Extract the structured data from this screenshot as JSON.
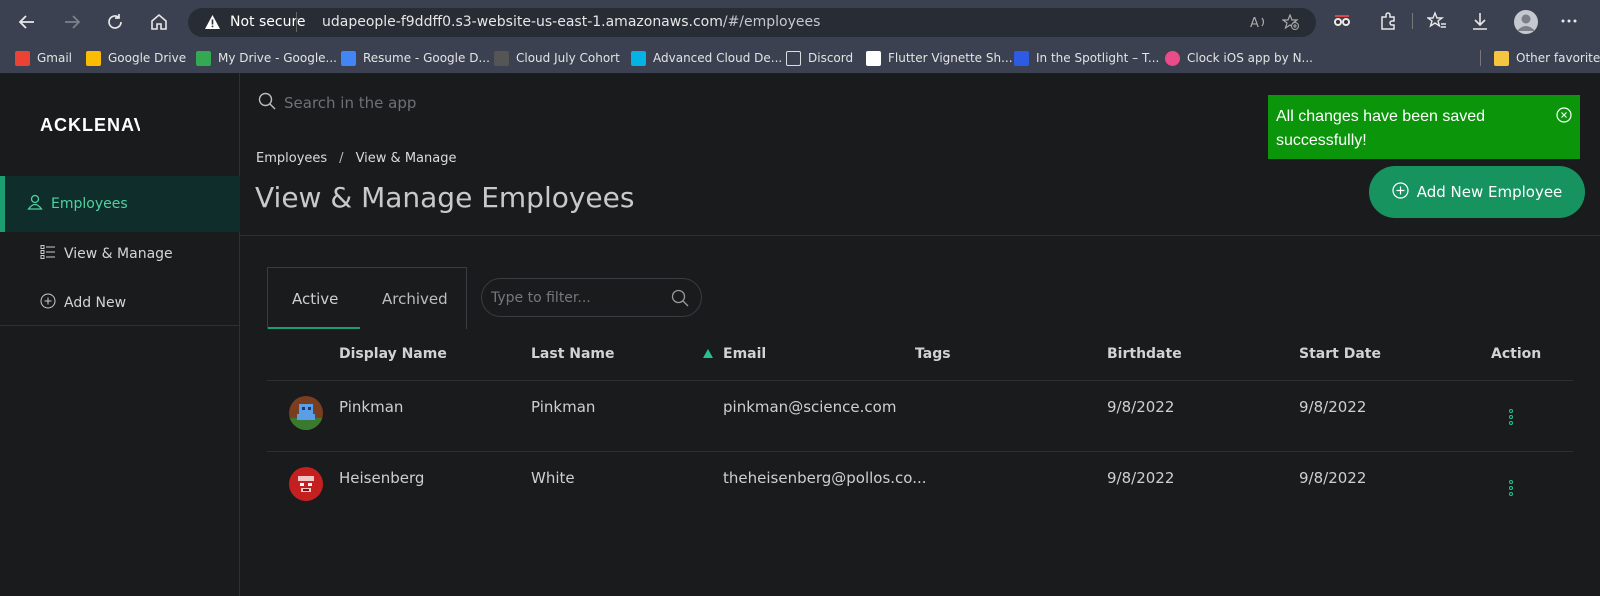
{
  "browser": {
    "not_secure": "Not secure",
    "url_host": "udapeople-f9ddff0.s3-website-us-east-1.amazonaws.com",
    "url_path": "/#/employees",
    "bookmarks": [
      {
        "label": "Gmail",
        "color": "#ea4335"
      },
      {
        "label": "Google Drive",
        "color": "#fbbc04"
      },
      {
        "label": "My Drive - Google...",
        "color": "#34a853"
      },
      {
        "label": "Resume - Google D...",
        "color": "#4285f4"
      },
      {
        "label": "Cloud July Cohort",
        "color": "#555555"
      },
      {
        "label": "Advanced Cloud De...",
        "color": "#02b3e4"
      },
      {
        "label": "Discord",
        "color": "#dddddd"
      },
      {
        "label": "Flutter Vignette Sh...",
        "color": "#1b1b2f"
      },
      {
        "label": "In the Spotlight – T...",
        "color": "#2d5be3"
      },
      {
        "label": "Clock iOS app by N...",
        "color": "#ea4c89"
      }
    ],
    "other_favorites": "Other favorites"
  },
  "sidebar": {
    "logo": "ACKLENAVENUE",
    "items": [
      {
        "label": "Employees",
        "icon": "person-icon"
      },
      {
        "label": "View & Manage",
        "icon": "list-icon"
      },
      {
        "label": "Add New",
        "icon": "plus-circle-icon"
      }
    ]
  },
  "search": {
    "placeholder": "Search in the app"
  },
  "breadcrumb": {
    "first": "Employees",
    "sep": "/",
    "second": "View & Manage"
  },
  "page_title": "View & Manage Employees",
  "add_button": "Add New Employee",
  "toast": {
    "message": "All changes have been saved successfully!",
    "color": "#0a950a"
  },
  "tabs": {
    "active": "Active",
    "archived": "Archived"
  },
  "filter": {
    "placeholder": "Type to filter..."
  },
  "table": {
    "headers": [
      "Display Name",
      "Last Name",
      "Email",
      "Tags",
      "Birthdate",
      "Start Date",
      "Action"
    ],
    "rows": [
      {
        "display_name": "Pinkman",
        "last_name": "Pinkman",
        "email": "pinkman@science.com",
        "tags": "",
        "birthdate": "9/8/2022",
        "start_date": "9/8/2022"
      },
      {
        "display_name": "Heisenberg",
        "last_name": "White",
        "email": "theheisenberg@pollos.co...",
        "tags": "",
        "birthdate": "9/8/2022",
        "start_date": "9/8/2022"
      }
    ]
  },
  "colors": {
    "accent": "#1d9e72",
    "button": "#16935f",
    "sort": "#26c28e"
  }
}
